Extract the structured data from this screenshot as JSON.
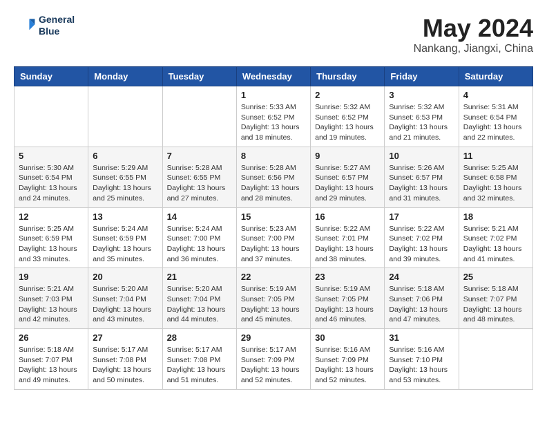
{
  "header": {
    "logo_line1": "General",
    "logo_line2": "Blue",
    "main_title": "May 2024",
    "subtitle": "Nankang, Jiangxi, China"
  },
  "weekdays": [
    "Sunday",
    "Monday",
    "Tuesday",
    "Wednesday",
    "Thursday",
    "Friday",
    "Saturday"
  ],
  "weeks": [
    [
      {
        "day": "",
        "info": ""
      },
      {
        "day": "",
        "info": ""
      },
      {
        "day": "",
        "info": ""
      },
      {
        "day": "1",
        "info": "Sunrise: 5:33 AM\nSunset: 6:52 PM\nDaylight: 13 hours and 18 minutes."
      },
      {
        "day": "2",
        "info": "Sunrise: 5:32 AM\nSunset: 6:52 PM\nDaylight: 13 hours and 19 minutes."
      },
      {
        "day": "3",
        "info": "Sunrise: 5:32 AM\nSunset: 6:53 PM\nDaylight: 13 hours and 21 minutes."
      },
      {
        "day": "4",
        "info": "Sunrise: 5:31 AM\nSunset: 6:54 PM\nDaylight: 13 hours and 22 minutes."
      }
    ],
    [
      {
        "day": "5",
        "info": "Sunrise: 5:30 AM\nSunset: 6:54 PM\nDaylight: 13 hours and 24 minutes."
      },
      {
        "day": "6",
        "info": "Sunrise: 5:29 AM\nSunset: 6:55 PM\nDaylight: 13 hours and 25 minutes."
      },
      {
        "day": "7",
        "info": "Sunrise: 5:28 AM\nSunset: 6:55 PM\nDaylight: 13 hours and 27 minutes."
      },
      {
        "day": "8",
        "info": "Sunrise: 5:28 AM\nSunset: 6:56 PM\nDaylight: 13 hours and 28 minutes."
      },
      {
        "day": "9",
        "info": "Sunrise: 5:27 AM\nSunset: 6:57 PM\nDaylight: 13 hours and 29 minutes."
      },
      {
        "day": "10",
        "info": "Sunrise: 5:26 AM\nSunset: 6:57 PM\nDaylight: 13 hours and 31 minutes."
      },
      {
        "day": "11",
        "info": "Sunrise: 5:25 AM\nSunset: 6:58 PM\nDaylight: 13 hours and 32 minutes."
      }
    ],
    [
      {
        "day": "12",
        "info": "Sunrise: 5:25 AM\nSunset: 6:59 PM\nDaylight: 13 hours and 33 minutes."
      },
      {
        "day": "13",
        "info": "Sunrise: 5:24 AM\nSunset: 6:59 PM\nDaylight: 13 hours and 35 minutes."
      },
      {
        "day": "14",
        "info": "Sunrise: 5:24 AM\nSunset: 7:00 PM\nDaylight: 13 hours and 36 minutes."
      },
      {
        "day": "15",
        "info": "Sunrise: 5:23 AM\nSunset: 7:00 PM\nDaylight: 13 hours and 37 minutes."
      },
      {
        "day": "16",
        "info": "Sunrise: 5:22 AM\nSunset: 7:01 PM\nDaylight: 13 hours and 38 minutes."
      },
      {
        "day": "17",
        "info": "Sunrise: 5:22 AM\nSunset: 7:02 PM\nDaylight: 13 hours and 39 minutes."
      },
      {
        "day": "18",
        "info": "Sunrise: 5:21 AM\nSunset: 7:02 PM\nDaylight: 13 hours and 41 minutes."
      }
    ],
    [
      {
        "day": "19",
        "info": "Sunrise: 5:21 AM\nSunset: 7:03 PM\nDaylight: 13 hours and 42 minutes."
      },
      {
        "day": "20",
        "info": "Sunrise: 5:20 AM\nSunset: 7:04 PM\nDaylight: 13 hours and 43 minutes."
      },
      {
        "day": "21",
        "info": "Sunrise: 5:20 AM\nSunset: 7:04 PM\nDaylight: 13 hours and 44 minutes."
      },
      {
        "day": "22",
        "info": "Sunrise: 5:19 AM\nSunset: 7:05 PM\nDaylight: 13 hours and 45 minutes."
      },
      {
        "day": "23",
        "info": "Sunrise: 5:19 AM\nSunset: 7:05 PM\nDaylight: 13 hours and 46 minutes."
      },
      {
        "day": "24",
        "info": "Sunrise: 5:18 AM\nSunset: 7:06 PM\nDaylight: 13 hours and 47 minutes."
      },
      {
        "day": "25",
        "info": "Sunrise: 5:18 AM\nSunset: 7:07 PM\nDaylight: 13 hours and 48 minutes."
      }
    ],
    [
      {
        "day": "26",
        "info": "Sunrise: 5:18 AM\nSunset: 7:07 PM\nDaylight: 13 hours and 49 minutes."
      },
      {
        "day": "27",
        "info": "Sunrise: 5:17 AM\nSunset: 7:08 PM\nDaylight: 13 hours and 50 minutes."
      },
      {
        "day": "28",
        "info": "Sunrise: 5:17 AM\nSunset: 7:08 PM\nDaylight: 13 hours and 51 minutes."
      },
      {
        "day": "29",
        "info": "Sunrise: 5:17 AM\nSunset: 7:09 PM\nDaylight: 13 hours and 52 minutes."
      },
      {
        "day": "30",
        "info": "Sunrise: 5:16 AM\nSunset: 7:09 PM\nDaylight: 13 hours and 52 minutes."
      },
      {
        "day": "31",
        "info": "Sunrise: 5:16 AM\nSunset: 7:10 PM\nDaylight: 13 hours and 53 minutes."
      },
      {
        "day": "",
        "info": ""
      }
    ]
  ]
}
